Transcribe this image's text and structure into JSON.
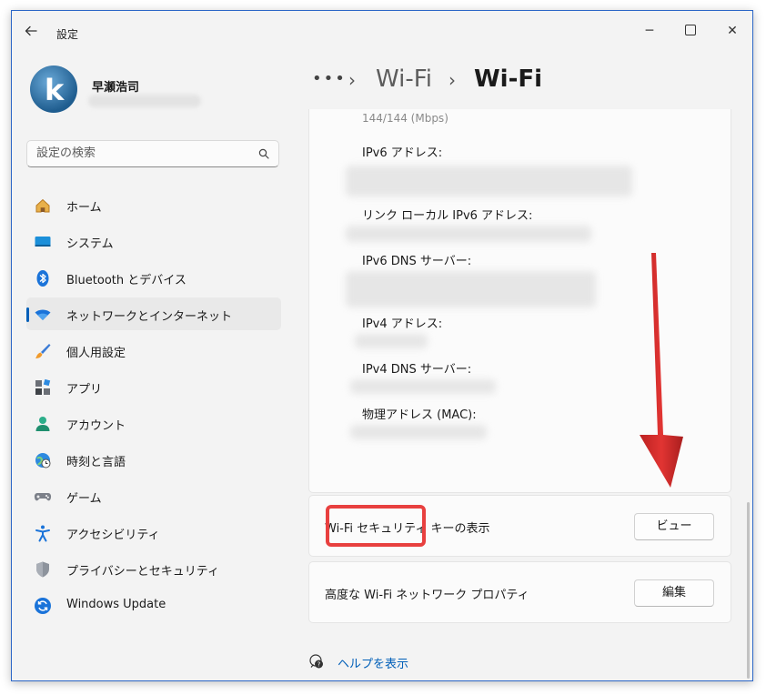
{
  "window": {
    "title": "設定",
    "controls": {
      "minimize": "─",
      "close": "✕"
    }
  },
  "user": {
    "name": "早瀬浩司",
    "avatar_letter": "k"
  },
  "search": {
    "placeholder": "設定の検索"
  },
  "nav": {
    "items": [
      {
        "label": "ホーム",
        "icon": "home-icon"
      },
      {
        "label": "システム",
        "icon": "system-icon"
      },
      {
        "label": "Bluetooth とデバイス",
        "icon": "bluetooth-icon"
      },
      {
        "label": "ネットワークとインターネット",
        "icon": "wifi-icon",
        "active": true
      },
      {
        "label": "個人用設定",
        "icon": "brush-icon"
      },
      {
        "label": "アプリ",
        "icon": "apps-icon"
      },
      {
        "label": "アカウント",
        "icon": "account-icon"
      },
      {
        "label": "時刻と言語",
        "icon": "time-language-icon"
      },
      {
        "label": "ゲーム",
        "icon": "gamepad-icon"
      },
      {
        "label": "アクセシビリティ",
        "icon": "accessibility-icon"
      },
      {
        "label": "プライバシーとセキュリティ",
        "icon": "shield-icon"
      },
      {
        "label": "Windows Update",
        "icon": "update-icon"
      }
    ]
  },
  "breadcrumb": {
    "ellipsis": "•••",
    "separator": "›",
    "item": "Wi-Fi",
    "current": "Wi-Fi"
  },
  "properties": {
    "speed": "144/144 (Mbps)",
    "ipv6_address": "IPv6 アドレス:",
    "link_local_ipv6": "リンク ローカル IPv6 アドレス:",
    "ipv6_dns": "IPv6 DNS サーバー:",
    "ipv4_address": "IPv4 アドレス:",
    "ipv4_dns": "IPv4 DNS サーバー:",
    "mac": "物理アドレス (MAC):"
  },
  "security_key": {
    "label": "Wi-Fi セキュリティ キーの表示",
    "button": "ビュー"
  },
  "advanced": {
    "label": "高度な Wi-Fi ネットワーク プロパティ",
    "button": "編集"
  },
  "help": {
    "label": "ヘルプを表示"
  },
  "colors": {
    "accent": "#005fb8",
    "highlight": "#e8403f",
    "arrow": "#d9201f"
  }
}
